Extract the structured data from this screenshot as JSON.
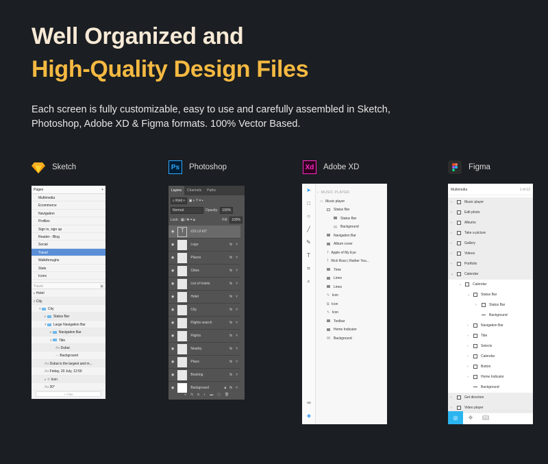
{
  "hero": {
    "title_line1": "Well Organized and",
    "title_line2": "High-Quality Design Files",
    "description": "Each screen is fully customizable, easy to use and carefully assembled in Sketch, Photoshop, Adobe XD & Figma formats. 100% Vector Based."
  },
  "apps": [
    {
      "name": "Sketch",
      "logo": "diamond-icon",
      "color": "#f7b125"
    },
    {
      "name": "Photoshop",
      "logo": "Ps",
      "color": "#31a8ff"
    },
    {
      "name": "Adobe XD",
      "logo": "Xd",
      "color": "#ff2bc2"
    },
    {
      "name": "Figma",
      "logo": "figma-icon",
      "color": "#2c2c2c"
    }
  ],
  "sketch": {
    "pages_label": "Pages",
    "add": "+",
    "pages": [
      "Multimedia",
      "Ecommerce",
      "Navigation",
      "Profiles",
      "Sign in, sign up",
      "Reader - Blog",
      "Social",
      "Travel",
      "Walkthroughs",
      "Stats",
      "Icons"
    ],
    "selected_page": "Travel",
    "section": "Travel",
    "layers": [
      {
        "t": "Hotel",
        "d": 0,
        "k": "arrow-r"
      },
      {
        "t": "City",
        "d": 0,
        "k": "arrow-d"
      },
      {
        "t": "City",
        "d": 1,
        "k": "folder-d"
      },
      {
        "t": "Status Bar",
        "d": 2,
        "k": "folder-r"
      },
      {
        "t": "Large Navigation Bar",
        "d": 2,
        "k": "folder-d"
      },
      {
        "t": "Navigation Bar",
        "d": 3,
        "k": "folder-r"
      },
      {
        "t": "Title",
        "d": 3,
        "k": "folder-d"
      },
      {
        "t": "Dubai",
        "d": 4,
        "k": "text"
      },
      {
        "t": "Background",
        "d": 4,
        "k": "line"
      },
      {
        "t": "Dubai is the largest and m...",
        "d": 2,
        "k": "text"
      },
      {
        "t": "Friday, 20 July, 12:50",
        "d": 2,
        "k": "text"
      },
      {
        "t": "Icon",
        "d": 2,
        "k": "symbol"
      },
      {
        "t": "20°",
        "d": 2,
        "k": "text"
      }
    ],
    "filter_placeholder": "Filter"
  },
  "photoshop": {
    "tabs": [
      "Layers",
      "Channels",
      "Paths"
    ],
    "kind": "Kind",
    "blend": "Normal",
    "opacity_label": "Opacity:",
    "opacity": "100%",
    "lock_label": "Lock:",
    "fill_label": "Fill:",
    "fill": "100%",
    "layers": [
      "iOS UI KIT",
      "Logo",
      "Places",
      "Cities",
      "List of hotels",
      "Hotel",
      "City",
      "Flights search",
      "Flights",
      "Nearby",
      "Place",
      "Booking",
      "Background"
    ],
    "fx": "fx"
  },
  "xd": {
    "back_label": "MUSIC PLAYER",
    "layers": [
      {
        "t": "Music player",
        "d": 0,
        "k": "board"
      },
      {
        "t": "Status Bar",
        "d": 1,
        "k": "group-open"
      },
      {
        "t": "Status Bar",
        "d": 2,
        "k": "group"
      },
      {
        "t": "Background",
        "d": 2,
        "k": "rect"
      },
      {
        "t": "Navigation Bar",
        "d": 1,
        "k": "group"
      },
      {
        "t": "Album cover",
        "d": 1,
        "k": "group"
      },
      {
        "t": "Apple of My Eye",
        "d": 1,
        "k": "text"
      },
      {
        "t": "Rick Ross | Rather You...",
        "d": 1,
        "k": "text"
      },
      {
        "t": "Time",
        "d": 1,
        "k": "group"
      },
      {
        "t": "Lines",
        "d": 1,
        "k": "group"
      },
      {
        "t": "Lines",
        "d": 1,
        "k": "group"
      },
      {
        "t": "Icon",
        "d": 1,
        "k": "pen"
      },
      {
        "t": "Icon",
        "d": 1,
        "k": "symbol"
      },
      {
        "t": "Icon",
        "d": 1,
        "k": "pen"
      },
      {
        "t": "Toolbar",
        "d": 1,
        "k": "group"
      },
      {
        "t": "Home Indicator",
        "d": 1,
        "k": "group"
      },
      {
        "t": "Background",
        "d": 1,
        "k": "rect"
      }
    ]
  },
  "figma": {
    "page": "Multimedia",
    "page_count": "1 of 12",
    "layers": [
      {
        "t": "Music player",
        "d": 0,
        "c": ">",
        "g": 1
      },
      {
        "t": "Edit photo",
        "d": 0,
        "c": ">",
        "g": 1
      },
      {
        "t": "Albums",
        "d": 0,
        "c": ">",
        "g": 1
      },
      {
        "t": "Take a picture",
        "d": 0,
        "c": ">",
        "g": 1
      },
      {
        "t": "Gallery",
        "d": 0,
        "c": ">",
        "g": 1
      },
      {
        "t": "Videos",
        "d": 0,
        "c": ">",
        "g": 1
      },
      {
        "t": "Portfolio",
        "d": 0,
        "c": ">",
        "g": 1
      },
      {
        "t": "Calendar",
        "d": 0,
        "c": "v",
        "g": 1
      },
      {
        "t": "Calendar",
        "d": 1,
        "c": "v"
      },
      {
        "t": "Status Bar",
        "d": 2,
        "c": "v"
      },
      {
        "t": "Status Bar",
        "d": 3,
        "c": ">"
      },
      {
        "t": "Background",
        "d": 3,
        "c": ""
      },
      {
        "t": "Navigation Bar",
        "d": 2,
        "c": ">"
      },
      {
        "t": "Title",
        "d": 2,
        "c": ">"
      },
      {
        "t": "Selects",
        "d": 2,
        "c": ">"
      },
      {
        "t": "Calendar",
        "d": 2,
        "c": ">"
      },
      {
        "t": "Button",
        "d": 2,
        "c": ">"
      },
      {
        "t": "Home Indicator",
        "d": 2,
        "c": ">"
      },
      {
        "t": "Background",
        "d": 2,
        "c": ""
      },
      {
        "t": "Get direction",
        "d": 0,
        "c": ">",
        "g": 1
      },
      {
        "t": "Video player",
        "d": 0,
        "c": ">",
        "g": 1
      }
    ]
  }
}
